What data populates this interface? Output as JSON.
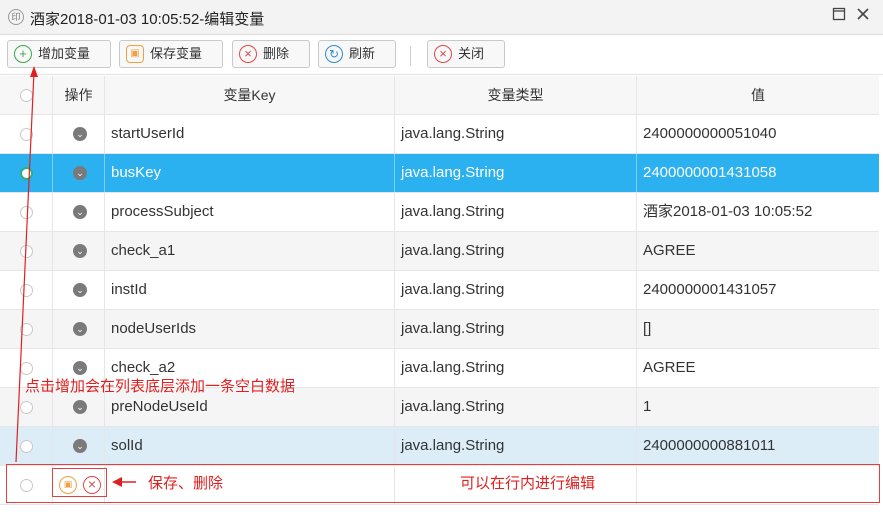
{
  "window": {
    "title": "酒家2018-01-03 10:05:52-编辑变量",
    "title_icon": "app-logo-icon",
    "maximize_icon": "maximize-icon",
    "close_icon": "close-icon"
  },
  "toolbar": {
    "buttons": [
      {
        "label": "增加变量",
        "icon": "plus-circle-icon",
        "color": "#3aa84a"
      },
      {
        "label": "保存变量",
        "icon": "save-icon",
        "color": "#f0a040"
      },
      {
        "label": "删除",
        "icon": "delete-x-icon",
        "color": "#e04848"
      },
      {
        "label": "刷新",
        "icon": "refresh-icon",
        "color": "#2b8ed8"
      },
      {
        "label": "关闭",
        "icon": "close-x-icon",
        "color": "#e04848"
      }
    ]
  },
  "table": {
    "headers": [
      "操作",
      "变量Key",
      "变量类型",
      "值"
    ],
    "rows": [
      {
        "key": "startUserId",
        "type": "java.lang.String",
        "value": "2400000000051040",
        "state": "normal"
      },
      {
        "key": "busKey",
        "type": "java.lang.String",
        "value": "2400000001431058",
        "state": "selected"
      },
      {
        "key": "processSubject",
        "type": "java.lang.String",
        "value": "酒家2018-01-03 10:05:52",
        "state": "normal"
      },
      {
        "key": "check_a1",
        "type": "java.lang.String",
        "value": "AGREE",
        "state": "alt"
      },
      {
        "key": "instId",
        "type": "java.lang.String",
        "value": "2400000001431057",
        "state": "normal"
      },
      {
        "key": "nodeUserIds",
        "type": "java.lang.String",
        "value": "[]",
        "state": "alt"
      },
      {
        "key": "check_a2",
        "type": "java.lang.String",
        "value": "AGREE",
        "state": "normal"
      },
      {
        "key": "preNodeUseId",
        "type": "java.lang.String",
        "value": "1",
        "state": "alt"
      },
      {
        "key": "solId",
        "type": "java.lang.String",
        "value": "2400000000881011",
        "state": "hover"
      }
    ],
    "new_row": {
      "key": "",
      "type": "",
      "value": ""
    }
  },
  "annotations": {
    "add_note": "点击增加会在列表底层添加一条空白数据",
    "save_delete_note": "保存、删除",
    "inline_edit_note": "可以在行内进行编辑",
    "color": "#e02020"
  }
}
